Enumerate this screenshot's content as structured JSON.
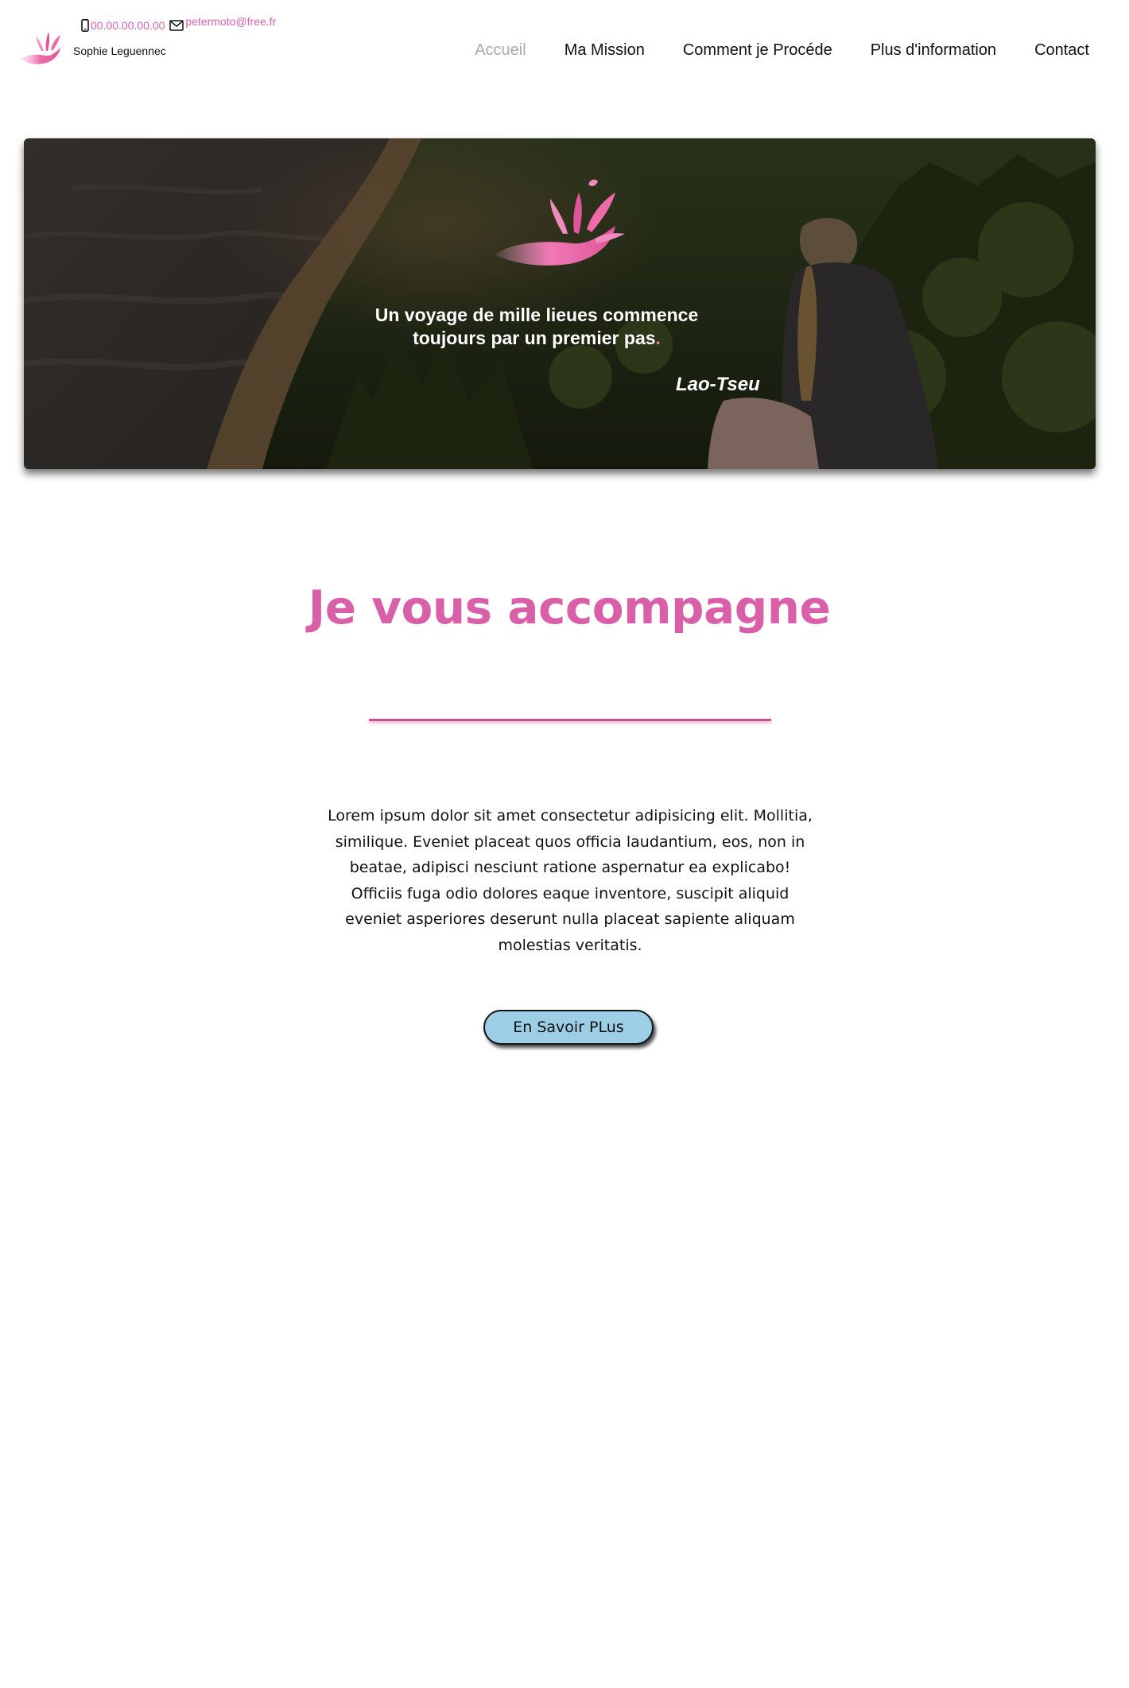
{
  "header": {
    "brand_name": "Sophie Leguennec",
    "phone": "00.00.00.00.00",
    "email": "petermoto@free.fr",
    "nav": [
      {
        "label": "Accueil",
        "active": true
      },
      {
        "label": "Ma Mission",
        "active": false
      },
      {
        "label": "Comment je Procéde",
        "active": false
      },
      {
        "label": "Plus d'information",
        "active": false
      },
      {
        "label": "Contact",
        "active": false
      }
    ]
  },
  "hero": {
    "quote_line1": "Un voyage de mille lieues commence",
    "quote_line2": "toujours par un premier pas",
    "quote_end": ".",
    "author": "Lao-Tseu"
  },
  "main": {
    "title": "Je vous accompagne",
    "intro": "Lorem ipsum dolor sit amet consectetur adipisicing elit. Mollitia, similique. Eveniet placeat quos officia laudantium, eos, non in beatae, adipisci nesciunt ratione aspernatur ea explicabo! Officiis fuga odio dolores eaque inventore, suscipit aliquid eveniet asperiores deserunt nulla placeat sapiente aliquam molestias veritatis.",
    "cta_label": "En Savoir PLus"
  },
  "colors": {
    "brand_pink": "#d95fa8",
    "button_blue": "#9ccfe6",
    "nav_active": "#a9a9a9"
  },
  "icons": {
    "phone": "phone-icon",
    "email": "mail-icon",
    "logo": "hand-splash-logo"
  }
}
